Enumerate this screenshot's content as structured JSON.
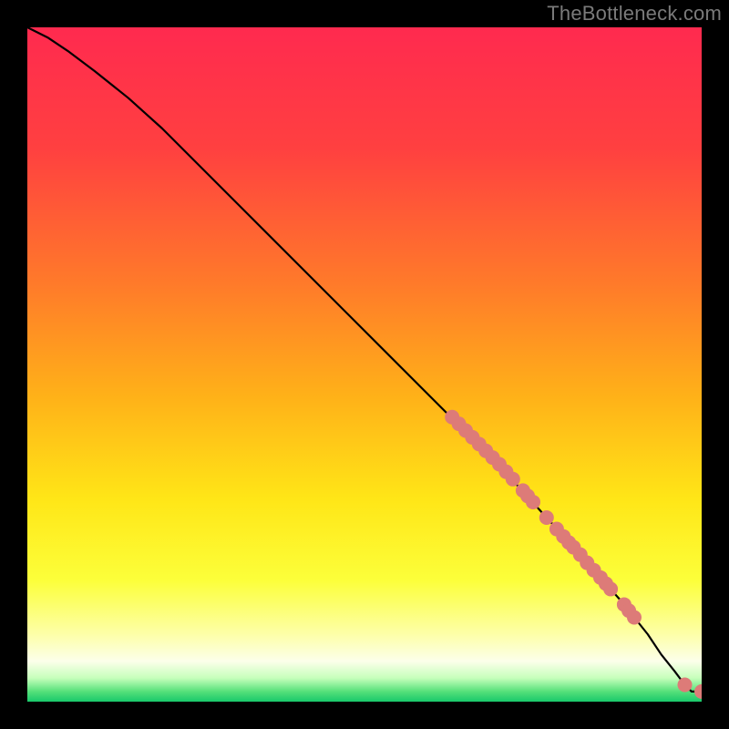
{
  "watermark": "TheBottleneck.com",
  "chart_data": {
    "type": "line",
    "title": "",
    "xlabel": "",
    "ylabel": "",
    "xlim": [
      0,
      100
    ],
    "ylim": [
      0,
      100
    ],
    "background_gradient": {
      "stops": [
        {
          "offset": 0.0,
          "color": "#ff2a4f"
        },
        {
          "offset": 0.18,
          "color": "#ff4040"
        },
        {
          "offset": 0.38,
          "color": "#ff7a2a"
        },
        {
          "offset": 0.55,
          "color": "#ffb218"
        },
        {
          "offset": 0.7,
          "color": "#ffe617"
        },
        {
          "offset": 0.82,
          "color": "#fcff3a"
        },
        {
          "offset": 0.9,
          "color": "#fdffa8"
        },
        {
          "offset": 0.94,
          "color": "#fcffea"
        },
        {
          "offset": 0.965,
          "color": "#c6ffbb"
        },
        {
          "offset": 0.985,
          "color": "#55e07a"
        },
        {
          "offset": 1.0,
          "color": "#19c96b"
        }
      ]
    },
    "curve": {
      "x": [
        0,
        3,
        6,
        10,
        15,
        20,
        30,
        40,
        50,
        60,
        70,
        80,
        88,
        92,
        94,
        96,
        97.5,
        98.5,
        100
      ],
      "y": [
        100,
        98.5,
        96.5,
        93.5,
        89.5,
        85,
        75,
        65,
        55,
        45,
        35,
        24,
        15,
        10,
        7,
        4.5,
        2.5,
        1.5,
        1.5
      ]
    },
    "markers": {
      "color": "#dd7b78",
      "radius": 8,
      "points": [
        {
          "x": 63,
          "y": 42.2
        },
        {
          "x": 64,
          "y": 41.2
        },
        {
          "x": 65,
          "y": 40.2
        },
        {
          "x": 66,
          "y": 39.2
        },
        {
          "x": 67,
          "y": 38.2
        },
        {
          "x": 68,
          "y": 37.2
        },
        {
          "x": 69,
          "y": 36.2
        },
        {
          "x": 70,
          "y": 35.2
        },
        {
          "x": 71,
          "y": 34.1
        },
        {
          "x": 72,
          "y": 33.0
        },
        {
          "x": 73.5,
          "y": 31.3
        },
        {
          "x": 74.2,
          "y": 30.5
        },
        {
          "x": 75,
          "y": 29.6
        },
        {
          "x": 77,
          "y": 27.3
        },
        {
          "x": 78.5,
          "y": 25.6
        },
        {
          "x": 79.5,
          "y": 24.5
        },
        {
          "x": 80.3,
          "y": 23.6
        },
        {
          "x": 81,
          "y": 22.9
        },
        {
          "x": 82,
          "y": 21.8
        },
        {
          "x": 83,
          "y": 20.6
        },
        {
          "x": 84,
          "y": 19.5
        },
        {
          "x": 85,
          "y": 18.4
        },
        {
          "x": 85.8,
          "y": 17.5
        },
        {
          "x": 86.5,
          "y": 16.7
        },
        {
          "x": 88.5,
          "y": 14.4
        },
        {
          "x": 89.2,
          "y": 13.5
        },
        {
          "x": 90,
          "y": 12.5
        },
        {
          "x": 97.5,
          "y": 2.5
        },
        {
          "x": 100,
          "y": 1.5
        }
      ]
    }
  }
}
